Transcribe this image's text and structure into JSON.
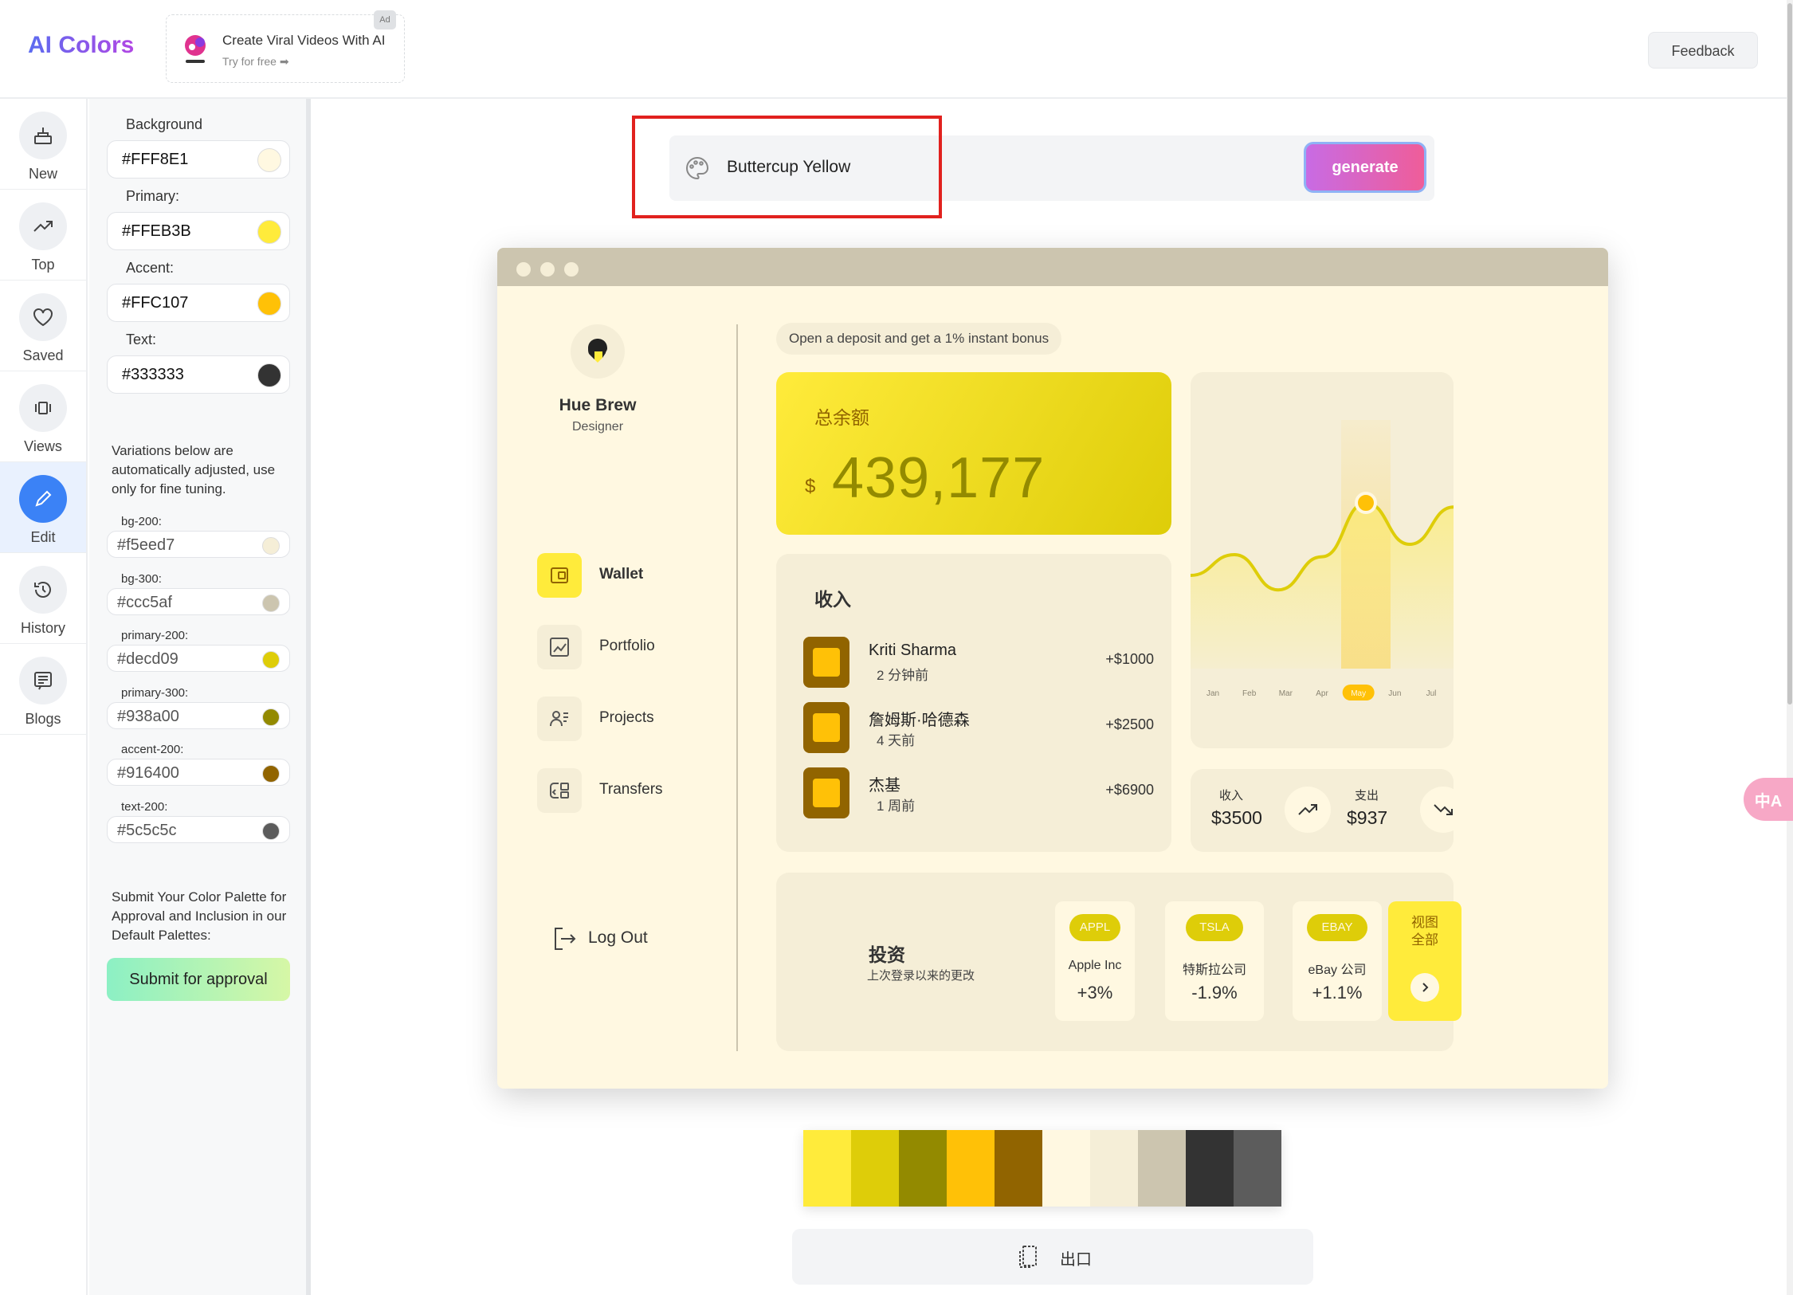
{
  "app": {
    "logo": "AI Colors",
    "feedback_label": "Feedback"
  },
  "ad": {
    "badge": "Ad",
    "title": "Create Viral Videos With AI",
    "subtitle": "Try for free ➡"
  },
  "rail": {
    "items": [
      {
        "label": "New",
        "icon": "new-icon"
      },
      {
        "label": "Top",
        "icon": "trending-icon"
      },
      {
        "label": "Saved",
        "icon": "heart-icon"
      },
      {
        "label": "Views",
        "icon": "views-icon"
      },
      {
        "label": "Edit",
        "icon": "pencil-icon",
        "active": true
      },
      {
        "label": "History",
        "icon": "history-icon"
      },
      {
        "label": "Blogs",
        "icon": "blog-icon"
      }
    ]
  },
  "panel": {
    "background": {
      "label": "Background",
      "value": "#FFF8E1",
      "color": "#FFF8E1"
    },
    "primary": {
      "label": "Primary:",
      "value": "#FFEB3B",
      "color": "#FFEB3B"
    },
    "accent": {
      "label": "Accent:",
      "value": "#FFC107",
      "color": "#FFC107"
    },
    "text": {
      "label": "Text:",
      "value": "#333333",
      "color": "#333333"
    },
    "variations_note": "Variations below are automatically adjusted, use only for fine tuning.",
    "variations": [
      {
        "label": "bg-200:",
        "value": "#f5eed7",
        "color": "#f5eed7"
      },
      {
        "label": "bg-300:",
        "value": "#ccc5af",
        "color": "#ccc5af"
      },
      {
        "label": "primary-200:",
        "value": "#decd09",
        "color": "#decd09"
      },
      {
        "label": "primary-300:",
        "value": "#938a00",
        "color": "#938a00"
      },
      {
        "label": "accent-200:",
        "value": "#916400",
        "color": "#916400"
      },
      {
        "label": "text-200:",
        "value": "#5c5c5c",
        "color": "#5c5c5c"
      }
    ],
    "submit_note": "Submit Your Color Palette for Approval and Inclusion in our Default Palettes:",
    "submit_label": "Submit for approval"
  },
  "search": {
    "value": "Buttercup Yellow",
    "generate_label": "generate"
  },
  "preview": {
    "profile": {
      "name": "Hue Brew",
      "role": "Designer"
    },
    "nav": [
      {
        "label": "Wallet",
        "active": true
      },
      {
        "label": "Portfolio"
      },
      {
        "label": "Projects"
      },
      {
        "label": "Transfers"
      }
    ],
    "logout_label": "Log Out",
    "promo": "Open a deposit and get a 1% instant bonus",
    "balance": {
      "label": "总余额",
      "currency": "$",
      "value": "439,177"
    },
    "income": {
      "title": "收入",
      "transactions": [
        {
          "name": "Kriti Sharma",
          "time": "2 分钟前",
          "amount": "+$1000"
        },
        {
          "name": "詹姆斯·哈德森",
          "time": "4 天前",
          "amount": "+$2500"
        },
        {
          "name": "杰基",
          "time": "1 周前",
          "amount": "+$6900"
        }
      ]
    },
    "stats": {
      "income_label": "收入",
      "income_value": "$3500",
      "expense_label": "支出",
      "expense_value": "$937"
    },
    "invest": {
      "title": "投资",
      "subtitle": "上次登录以来的更改",
      "stocks": [
        {
          "ticker": "APPL",
          "name": "Apple Inc",
          "change": "+3%"
        },
        {
          "ticker": "TSLA",
          "name": "特斯拉公司",
          "change": "-1.9%"
        },
        {
          "ticker": "EBAY",
          "name": "eBay 公司",
          "change": "+1.1%"
        }
      ],
      "view_all": "视图\n全部"
    }
  },
  "chart_data": {
    "type": "area",
    "categories": [
      "Jan",
      "Feb",
      "Mar",
      "Apr",
      "May",
      "Jun",
      "Jul"
    ],
    "values": [
      45,
      55,
      38,
      54,
      80,
      60,
      78
    ],
    "highlight": "May",
    "ylim": [
      0,
      120
    ],
    "grid": false
  },
  "palette": [
    "#FFEB3B",
    "#decd09",
    "#938a00",
    "#FFC107",
    "#916400",
    "#FFF8E1",
    "#f5eed7",
    "#ccc5af",
    "#333333",
    "#5c5c5c"
  ],
  "export_label": "出口",
  "translate_label": "中A"
}
